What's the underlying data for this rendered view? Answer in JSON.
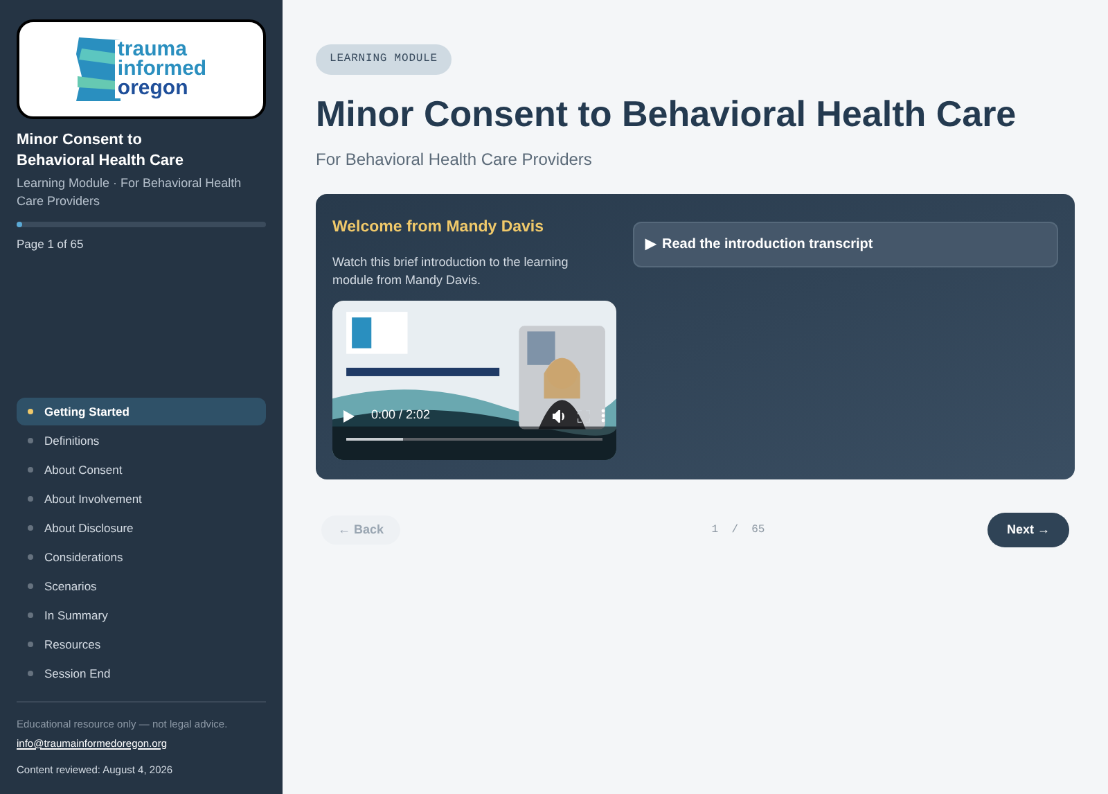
{
  "sidebar": {
    "logo": {
      "lines": [
        "trauma",
        "informed",
        "oregon"
      ]
    },
    "title": "Minor Consent to Behavioral Health Care",
    "subtitle": "Learning Module · For Behavioral Health Care Providers",
    "progress": {
      "level": 0.015,
      "label": "Page 1 of 65"
    },
    "items": [
      {
        "label": "Getting Started",
        "selected": true
      },
      {
        "label": "Definitions",
        "selected": false
      },
      {
        "label": "About Consent",
        "selected": false
      },
      {
        "label": "About Involvement",
        "selected": false
      },
      {
        "label": "About Disclosure",
        "selected": false
      },
      {
        "label": "Considerations",
        "selected": false
      },
      {
        "label": "Scenarios",
        "selected": false
      },
      {
        "label": "In Summary",
        "selected": false
      },
      {
        "label": "Resources",
        "selected": false
      },
      {
        "label": "Session End",
        "selected": false
      }
    ],
    "footer": {
      "disclaimer": "Educational resource only — not legal advice.",
      "email": "info@traumainformedoregon.org",
      "reviewed": "Content reviewed: August 4, 2026"
    }
  },
  "main": {
    "badge": "LEARNING MODULE",
    "title": "Minor Consent to Behavioral Health Care",
    "subtitle": "For Behavioral Health Care Providers",
    "card": {
      "heading": "Welcome from Mandy Davis",
      "text": "Watch this brief introduction to the learning module from Mandy Davis.",
      "video": {
        "kind": "picture",
        "time": "0:00 / 2:02",
        "level": 0.22
      },
      "transcript": {
        "marker": "▶",
        "label": "Read the introduction transcript",
        "expanded": false
      }
    },
    "pager": {
      "back": {
        "label": "← Back",
        "disabled": true
      },
      "count": "1  /  65",
      "next": {
        "label": "Next →",
        "disabled": false
      }
    }
  }
}
